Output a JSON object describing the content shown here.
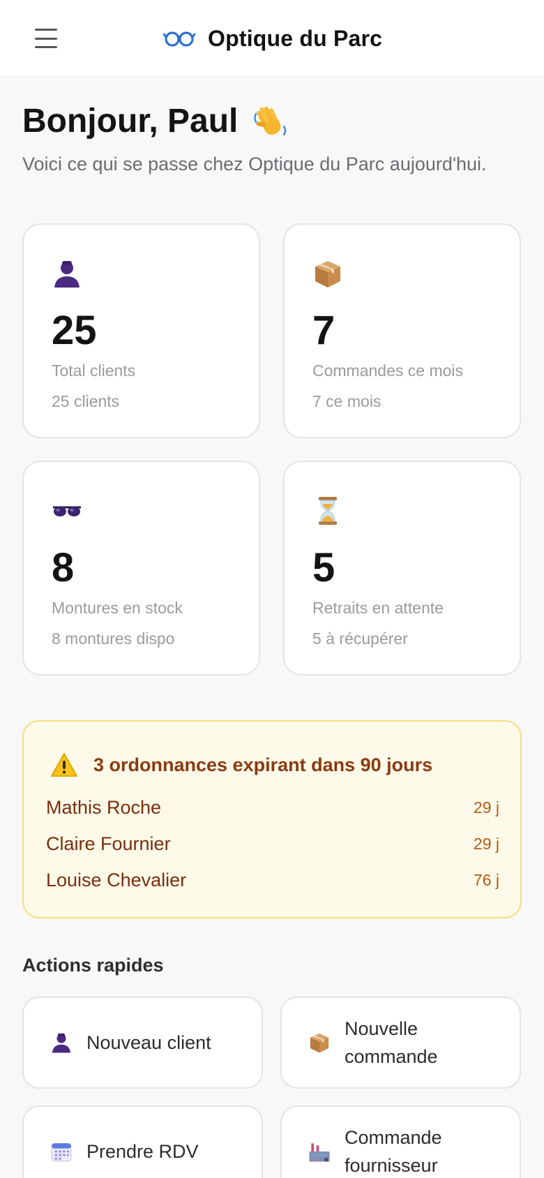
{
  "header": {
    "menu_icon": "hamburger-icon",
    "logo_icon": "glasses-icon",
    "title": "Optique du Parc"
  },
  "greeting": {
    "title": "Bonjour, Paul",
    "emoji_icon": "waving-hand-icon",
    "subtitle": "Voici ce qui se passe chez Optique du Parc aujourd'hui."
  },
  "stats": [
    {
      "icon": "person-icon",
      "value": "25",
      "label": "Total clients",
      "sub": "25 clients"
    },
    {
      "icon": "package-icon",
      "value": "7",
      "label": "Commandes ce mois",
      "sub": "7 ce mois"
    },
    {
      "icon": "sunglasses-icon",
      "value": "8",
      "label": "Montures en stock",
      "sub": "8 montures dispo"
    },
    {
      "icon": "hourglass-icon",
      "value": "5",
      "label": "Retraits en attente",
      "sub": "5 à récupérer"
    }
  ],
  "alert": {
    "icon": "warning-icon",
    "title": "3 ordonnances expirant dans 90 jours",
    "items": [
      {
        "name": "Mathis Roche",
        "days": "29 j"
      },
      {
        "name": "Claire Fournier",
        "days": "29 j"
      },
      {
        "name": "Louise Chevalier",
        "days": "76 j"
      }
    ]
  },
  "quick_actions": {
    "title": "Actions rapides",
    "items": [
      {
        "icon": "person-icon",
        "label": "Nouveau client"
      },
      {
        "icon": "package-icon",
        "label": "Nouvelle commande"
      },
      {
        "icon": "calendar-icon",
        "label": "Prendre RDV"
      },
      {
        "icon": "factory-icon",
        "label": "Commande fournisseur"
      }
    ]
  },
  "colors": {
    "accent": "#2d6fd0",
    "alert_bg": "#fefaea",
    "alert_border": "#f6dd7e",
    "alert_text": "#8a3a10",
    "icon_purple": "#4b2a82"
  }
}
